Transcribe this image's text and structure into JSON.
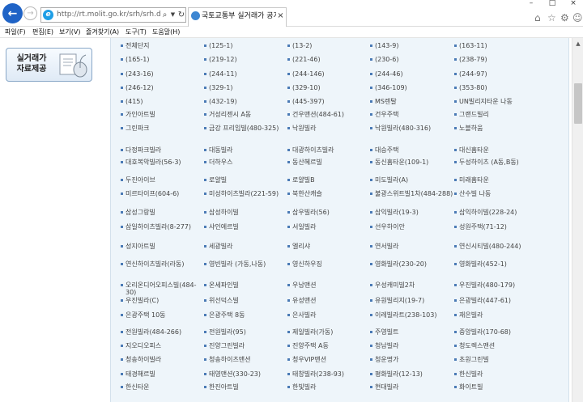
{
  "browser": {
    "url": "http://rt.molit.go.kr/srh/srh.do?menuGubr",
    "tab_title": "국토교통부 실거래가 공개...",
    "tab_close": "×",
    "window_min": "–",
    "window_max": "□",
    "window_close": "×"
  },
  "menu": [
    "파일(F)",
    "편집(E)",
    "보기(V)",
    "즐겨찾기(A)",
    "도구(T)",
    "도움말(H)"
  ],
  "sidebar": {
    "button_line1": "실거래가",
    "button_line2": "자료제공"
  },
  "complexes": [
    [
      "전체단지",
      "(125-1)",
      "(13-2)",
      "(143-9)",
      "(163-11)"
    ],
    [
      "(165-1)",
      "(219-12)",
      "(221-46)",
      "(230-6)",
      "(238-79)"
    ],
    [
      "(243-16)",
      "(244-11)",
      "(244-146)",
      "(244-46)",
      "(244-97)"
    ],
    [
      "(246-12)",
      "(329-1)",
      "(329-10)",
      "(346-109)",
      "(353-80)"
    ],
    [
      "(415)",
      "(432-19)",
      "(445-397)",
      "MS렌탈",
      "UN빌리지타운 나동"
    ],
    [
      "가인아트빌",
      "거성리젠시 A동",
      "건우맨션(484-61)",
      "건우주택",
      "그랜드빌리"
    ],
    [
      "그린파크",
      "금강 프리임빌(480-325)",
      "낙원빌라",
      "낙원빌라(480-316)",
      "노블하움"
    ],
    [
      "다정파크빌라",
      "대동빌라",
      "대광하이츠빌라",
      "대승주택",
      "대신홈타운"
    ],
    [
      "대호복악빌라(56-3)",
      "더하우스",
      "동산혜르빌",
      "동신홈타운(109-1)",
      "두성하이츠 (A동,B동)"
    ],
    [
      "두진아이브",
      "로얄빌",
      "로얄빌B",
      "미도빌라(A)",
      "미래홈타운"
    ],
    [
      "미르타이프(604-6)",
      "미성하이츠빌라(221-59)",
      "북한산캐슬",
      "불광스위트빌1차(484-288)",
      "산수빌 나동"
    ],
    [
      "삼성그랑빌",
      "삼성하이빌",
      "삼우빌라(56)",
      "삼익빌라(19-3)",
      "삼익하이빌(228-24)"
    ],
    [
      "삼일하이츠빌라(8-277)",
      "샤인에르빌",
      "서일빌라",
      "선우하이안",
      "성원주택(71-12)"
    ],
    [
      "성지아트빌",
      "세광빌라",
      "엘리샤",
      "연서빌라",
      "연신시티빌(480-244)"
    ],
    [
      "연신하이츠빌라(라동)",
      "영빈빌라 (가동,나동)",
      "영신하우징",
      "영화빌라(230-20)",
      "영화빌라(452-1)"
    ],
    [
      "오리온디어오피스빌(484-30)",
      "온세파인빌",
      "우남맨션",
      "우성캐미빌2차",
      "우진빌라(480-179)"
    ],
    [
      "우진빌라(C)",
      "위선덕스빌",
      "유성맨션",
      "유원빌리지(19-7)",
      "은광빌라(447-61)"
    ],
    [
      "은광주택 10동",
      "은광주택 8동",
      "은사빌라",
      "이레빌라트(238-103)",
      "재은빌라"
    ],
    [
      "전원빌라(484-266)",
      "전원빌라(95)",
      "제일빌라(가동)",
      "주영빌트",
      "중앙빌라(170-68)"
    ],
    [
      "지오디오피스",
      "진양그린빌라",
      "진양주택 A동",
      "청남빌라",
      "청도렉스맨션"
    ],
    [
      "청송하이빌라",
      "청송하이츠맨션",
      "청우VIP맨션",
      "청운명가",
      "초원그린빌"
    ],
    [
      "태경해르빌",
      "태영맨션(330-23)",
      "태창빌라(238-93)",
      "평화빌라(12-13)",
      "한신빌라"
    ],
    [
      "한신타운",
      "한진아트빌",
      "한빛빌라",
      "현대빌라",
      "화이트빌"
    ]
  ]
}
